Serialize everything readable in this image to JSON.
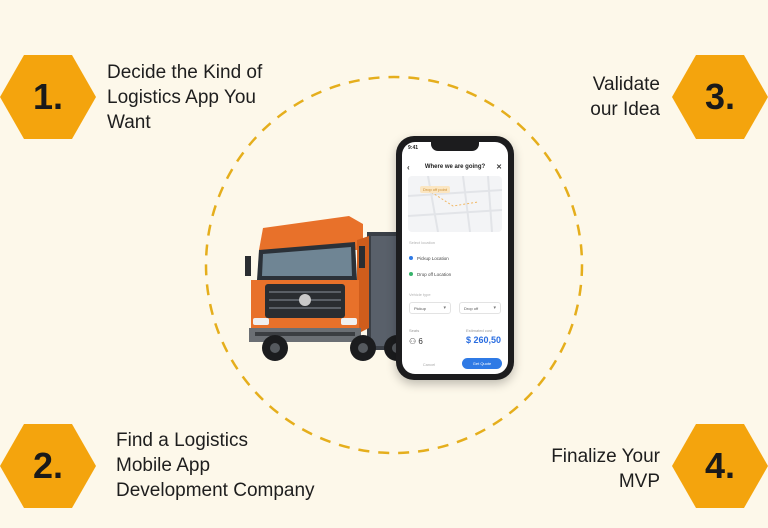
{
  "steps": [
    {
      "number": "1.",
      "lines": [
        "Decide the Kind of",
        "Logistics App You",
        "Want"
      ]
    },
    {
      "number": "2.",
      "lines": [
        "Find a Logistics",
        "Mobile App",
        "Development Company"
      ]
    },
    {
      "number": "3.",
      "lines": [
        "Validate",
        "our Idea"
      ]
    },
    {
      "number": "4.",
      "lines": [
        "Finalize Your",
        "MVP"
      ]
    }
  ],
  "phone": {
    "time": "9:41",
    "header_title": "Where we are going?",
    "map_pin_label": "Drop off point",
    "section_label": "Select location",
    "pickup_label": "Pickup Location",
    "dropoff_label": "Drop off Location",
    "vehicle_label": "Vehicle type",
    "select_left": "Pickup",
    "select_right": "Drop off",
    "seats_label": "Seats",
    "estimate_label": "Estimated cost",
    "seats_value": "6",
    "price": "$ 260,50",
    "cancel_label": "Cancel",
    "submit_label": "Get Quote"
  },
  "colors": {
    "background": "#fdf8ea",
    "hexagon": "#f4a40d",
    "ring": "#e5ae1c",
    "accent_blue": "#2f7ae5"
  },
  "icons": [
    "hexagon-badge",
    "dashed-circle",
    "truck-illustration",
    "smartphone-mockup"
  ]
}
